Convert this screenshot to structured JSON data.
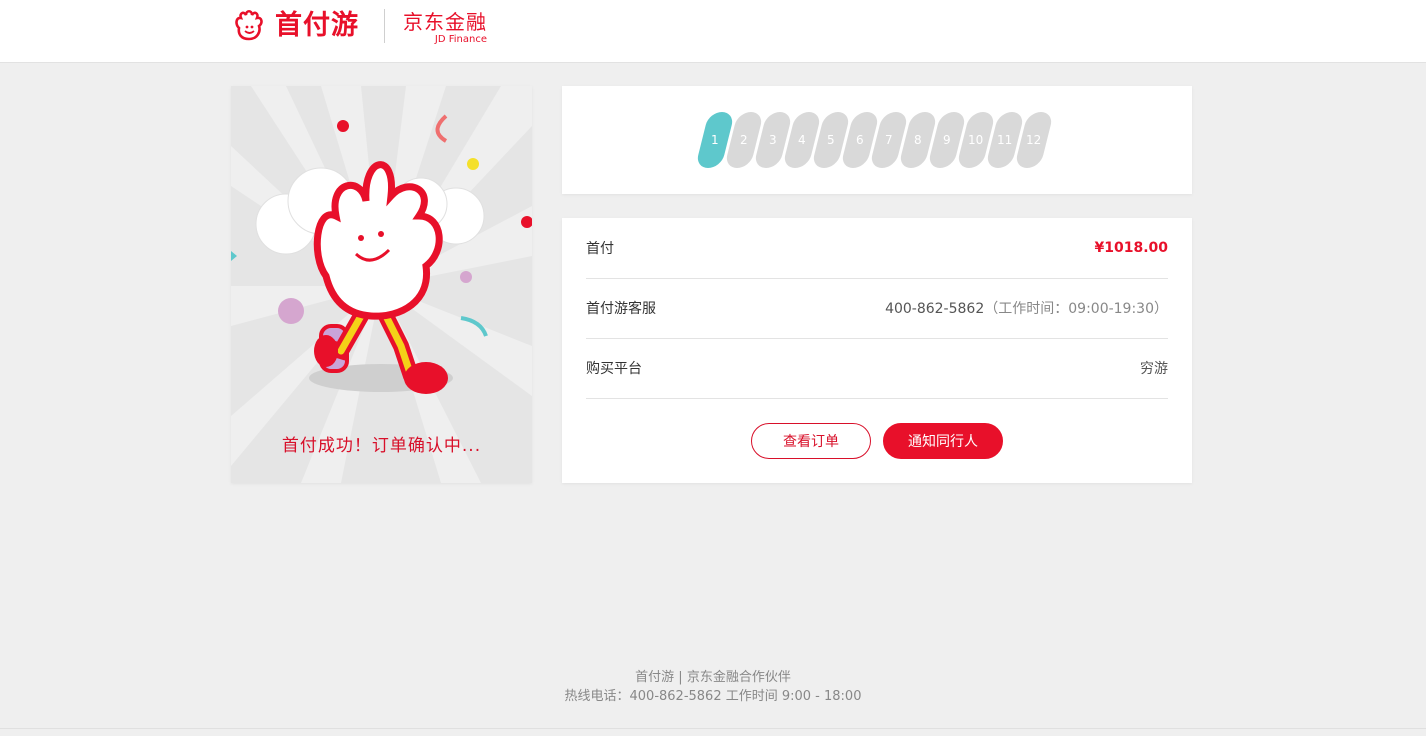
{
  "header": {
    "brand_name": "首付游",
    "partner_name_cn": "京东金融",
    "partner_name_en": "JD Finance"
  },
  "status_card": {
    "caption": "首付成功！订单确认中..."
  },
  "installments": {
    "active_step": 1,
    "steps": [
      "1",
      "2",
      "3",
      "4",
      "5",
      "6",
      "7",
      "8",
      "9",
      "10",
      "11",
      "12"
    ]
  },
  "details": {
    "down_payment_label": "首付",
    "down_payment_value": "¥1018.00",
    "service_label": "首付游客服",
    "service_phone": "400-862-5862",
    "service_hours": "（工作时间：09:00-19:30）",
    "platform_label": "购买平台",
    "platform_value": "穷游"
  },
  "actions": {
    "view_order": "查看订单",
    "notify_companions": "通知同行人"
  },
  "footer": {
    "line1": "首付游 | 京东金融合作伙伴",
    "line2": "热线电话：400-862-5862 工作时间 9:00 - 18:00"
  },
  "colors": {
    "brand_red": "#e8102a",
    "active_step": "#5ec8cc",
    "inactive_step": "#d9d9d9"
  }
}
